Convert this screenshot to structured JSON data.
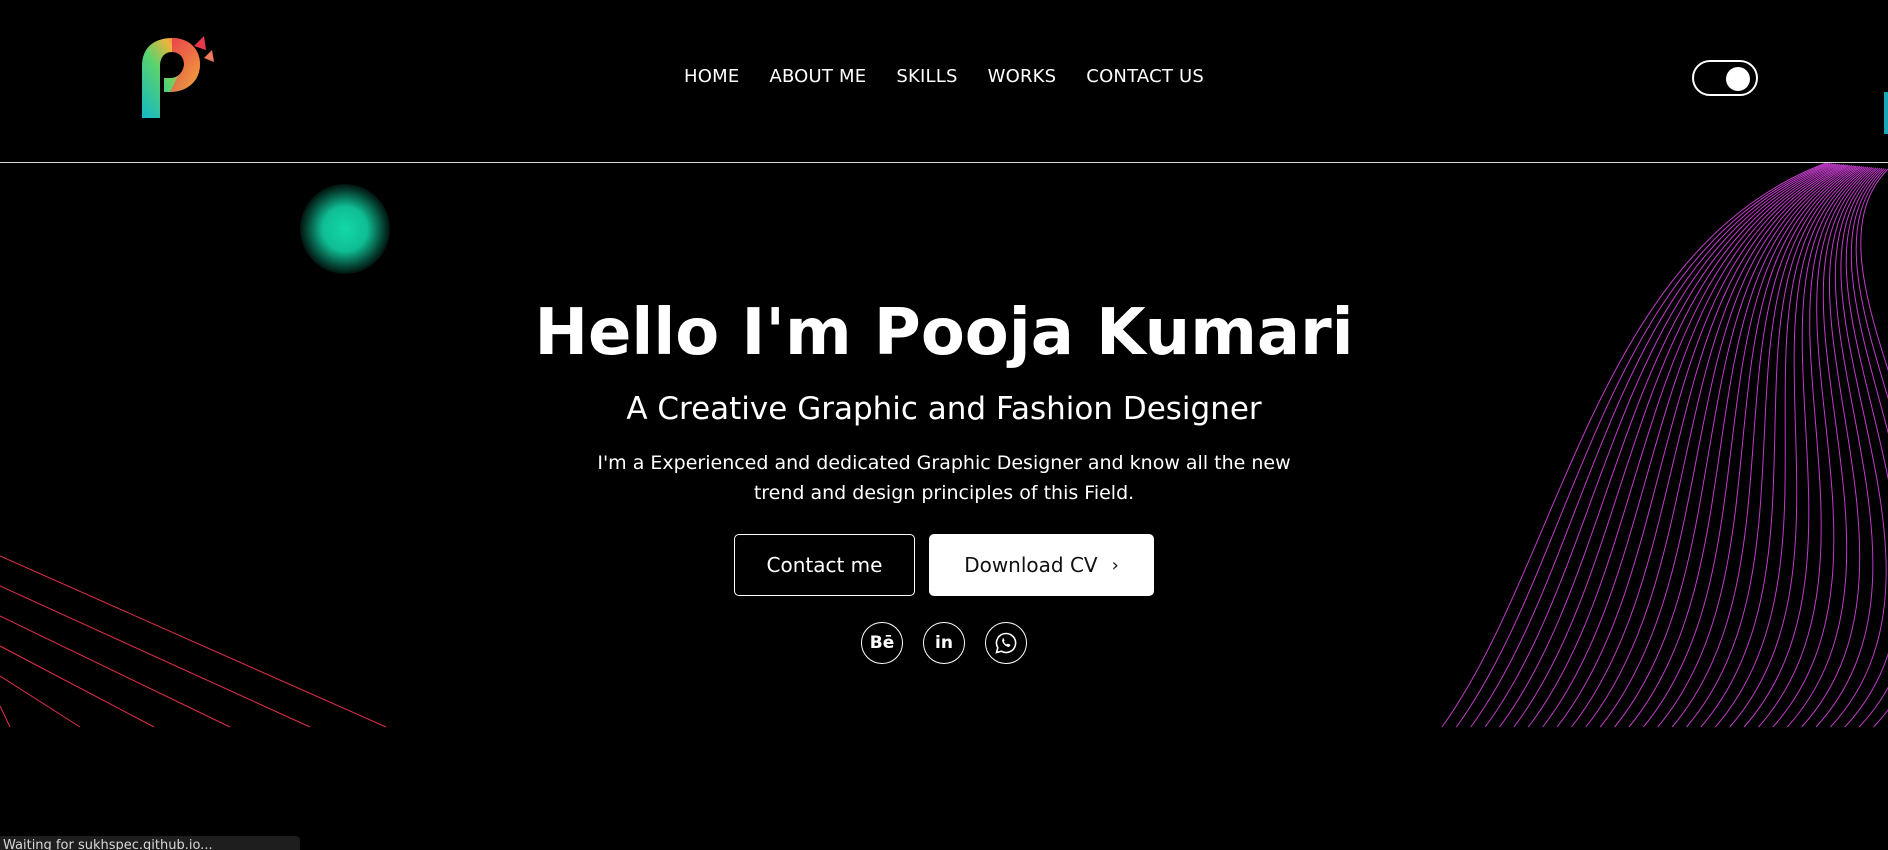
{
  "nav": {
    "items": [
      {
        "label": "HOME"
      },
      {
        "label": "ABOUT ME"
      },
      {
        "label": "SKILLS"
      },
      {
        "label": "WORKS"
      },
      {
        "label": "CONTACT US"
      }
    ]
  },
  "theme_toggle": {
    "state": "on"
  },
  "hero": {
    "title": "Hello I'm Pooja Kumari",
    "subtitle": "A Creative Graphic and Fashion Designer",
    "description": "I'm a Experienced and dedicated Graphic Designer and know all the new trend and design principles of this Field.",
    "contact_button": "Contact me",
    "download_button": "Download CV",
    "download_icon": "chevron-right-icon"
  },
  "social": {
    "items": [
      {
        "icon": "behance-icon",
        "glyph": "Bē"
      },
      {
        "icon": "linkedin-icon",
        "glyph": "in"
      },
      {
        "icon": "whatsapp-icon",
        "glyph": ""
      }
    ]
  },
  "status_bar": {
    "text": "Waiting for sukhspec.github.io..."
  },
  "colors": {
    "background": "#000000",
    "text": "#ffffff",
    "glow": "#12d8a8",
    "left_lines": "#e0304a",
    "right_lines": "#c03cc8",
    "logo_gradient": [
      "#16c6b0",
      "#f0c030",
      "#e8384e"
    ]
  }
}
